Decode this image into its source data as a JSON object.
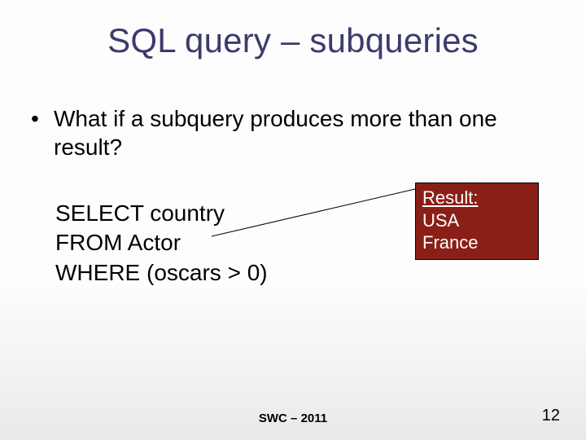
{
  "title": "SQL query – subqueries",
  "bullet0": "What if a subquery produces more than one result?",
  "sql": {
    "l1": "SELECT country",
    "l2": "FROM Actor",
    "l3": "WHERE (oscars > 0)"
  },
  "result": {
    "label": "Result:",
    "r1": "USA",
    "r2": "France"
  },
  "footer": "SWC – 2011",
  "page": "12"
}
